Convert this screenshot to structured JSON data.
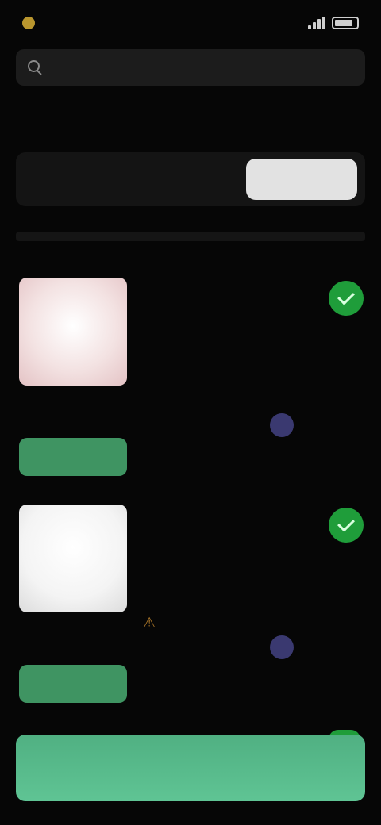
{
  "status_bar": {
    "time": "",
    "carrier": ""
  },
  "search": {
    "placeholder": "",
    "value": ""
  },
  "section": {
    "label": ""
  },
  "selector": {
    "value": "",
    "hint": "",
    "action_label": ""
  },
  "products": [
    {
      "title": "",
      "line1": "",
      "line2": "",
      "line3": "",
      "meta": "",
      "button_label": "",
      "stats": [
        "",
        "",
        "",
        ""
      ],
      "thumb_color": "#f3e2e2",
      "checked": true
    },
    {
      "title": "",
      "line1": "",
      "line2": "",
      "line3": "",
      "meta": "",
      "button_label": "",
      "stats": [
        "",
        "",
        "",
        ""
      ],
      "thumb_color": "#f4f4f4",
      "checked": true
    }
  ],
  "bottom": {
    "button_label": ""
  },
  "colors": {
    "accent_green": "#3f9462",
    "check_green": "#1f9d3a",
    "background": "#060606"
  },
  "icons": [
    "search-icon",
    "check-icon",
    "warning-icon",
    "user-icon",
    "battery-icon",
    "signal-icon"
  ]
}
